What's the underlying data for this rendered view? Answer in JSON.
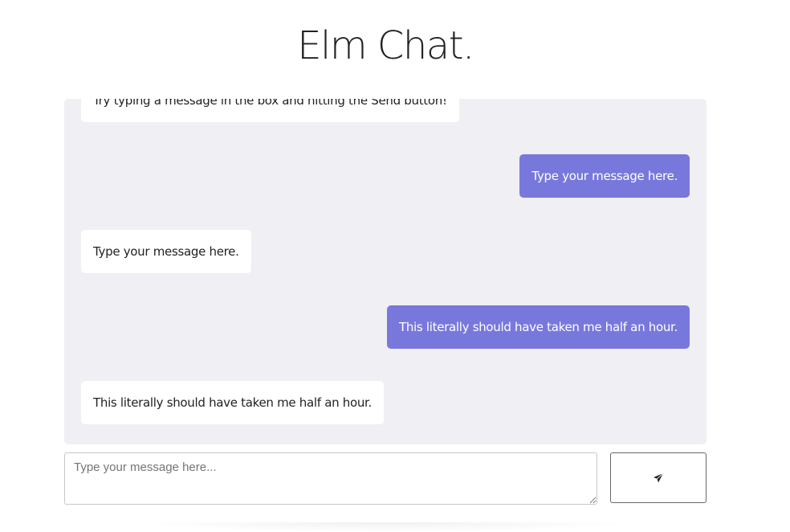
{
  "header": {
    "title": "Elm Chat."
  },
  "messages": [
    {
      "kind": "received",
      "text": "Try typing a message in the box and hitting the Send button!"
    },
    {
      "kind": "sent",
      "text": "Type your message here."
    },
    {
      "kind": "received",
      "text": "Type your message here."
    },
    {
      "kind": "sent",
      "text": "This literally should have taken me half an hour."
    },
    {
      "kind": "received",
      "text": "This literally should have taken me half an hour."
    }
  ],
  "composer": {
    "placeholder": "Type your message here...",
    "value": "",
    "send_icon": "paper-plane-icon"
  },
  "colors": {
    "chat_background": "#efeff4",
    "sent_bubble": "#7878dc",
    "received_bubble": "#ffffff"
  }
}
